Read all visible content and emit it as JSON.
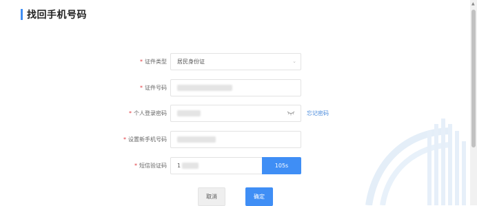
{
  "page": {
    "title": "找回手机号码"
  },
  "form": {
    "required_mark": "*",
    "id_type": {
      "label": "证件类型",
      "value": "居民身份证"
    },
    "id_number": {
      "label": "证件号码"
    },
    "password": {
      "label": "个人登录密码",
      "forgot_link": "忘记密码"
    },
    "new_phone": {
      "label": "设置新手机号码"
    },
    "sms_code": {
      "label": "短信验证码",
      "value": "1",
      "countdown_label": "105s"
    }
  },
  "buttons": {
    "cancel": "取消",
    "confirm": "确定"
  },
  "colors": {
    "accent": "#3f8ef5",
    "link": "#4a8bdc",
    "required": "#e0393e"
  }
}
